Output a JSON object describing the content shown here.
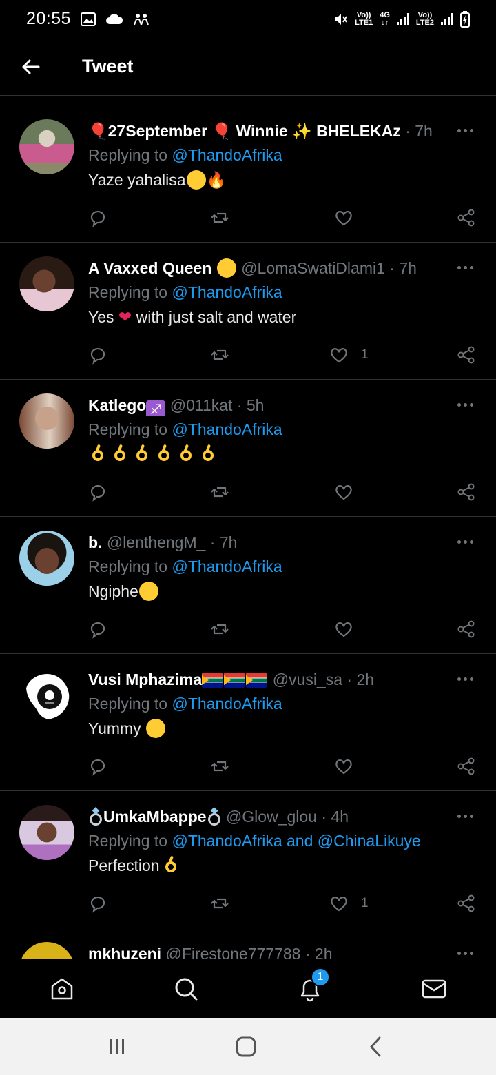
{
  "status_bar": {
    "time": "20:55",
    "sim1": "LTE1",
    "sim1_top": "Vo))",
    "sim2": "LTE2",
    "sim2_top": "Vo))",
    "net": "4G"
  },
  "header": {
    "title": "Tweet",
    "back_icon": "arrow-left-icon"
  },
  "tweets": [
    {
      "name": "27September",
      "name2": "Winnie",
      "name3": "BHELEKAᴢ",
      "handle": "",
      "time": "7h",
      "replying_prefix": "Replying to ",
      "replying_to": "@ThandoAfrika",
      "text": "Yaze yahalisa",
      "likes": "",
      "avatar_colors": [
        "#6b7a5a",
        "#c95b8f",
        "#d8d0c0"
      ]
    },
    {
      "name": "A Vaxxed Queen",
      "handle": "@LomaSwatiDlami1",
      "time": "7h",
      "replying_prefix": "Replying to ",
      "replying_to": "@ThandoAfrika",
      "text_a": "Yes",
      "text_b": "with just salt and water",
      "likes": "1",
      "avatar_colors": [
        "#5a3a2e",
        "#e8c7d4",
        "#2a1a14"
      ]
    },
    {
      "name": "Katlego",
      "handle": "@011kat",
      "time": "5h",
      "replying_prefix": "Replying to ",
      "replying_to": "@ThandoAfrika",
      "text": "",
      "likes": "",
      "avatar_colors": [
        "#c7a28a",
        "#7a4a36",
        "#e0cfc0"
      ]
    },
    {
      "name": "b.",
      "handle": "@lenthengM_",
      "time": "7h",
      "replying_prefix": "Replying to ",
      "replying_to": "@ThandoAfrika",
      "text": "Ngiphe",
      "likes": "",
      "avatar_colors": [
        "#1a1410",
        "#9ccfe8",
        "#6a4030"
      ]
    },
    {
      "name": "Vusi Mphazima",
      "handle": "@vusi_sa",
      "time": "2h",
      "replying_prefix": "Replying to ",
      "replying_to": "@ThandoAfrika",
      "text": "Yummy",
      "likes": "",
      "avatar_colors": [
        "#ffffff",
        "#111111",
        "#888888"
      ]
    },
    {
      "name": "UmkaMbappe",
      "handle": "@Glow_glou",
      "time": "4h",
      "replying_prefix": "Replying to ",
      "replying_to": "@ThandoAfrika",
      "replying_and": " and ",
      "replying_to2": "@ChinaLikuye",
      "text": "Perfection",
      "likes": "1",
      "avatar_colors": [
        "#d9c9e0",
        "#2a1a1a",
        "#b070c0"
      ]
    },
    {
      "name": "mkhuzeni",
      "handle": "@Firestone777788",
      "time": "2h",
      "avatar_colors": [
        "#d9b21a",
        "#e05a1a",
        "#6a2a8a"
      ]
    }
  ],
  "separator": "·",
  "bottom_nav": {
    "items": [
      "home-icon",
      "search-icon",
      "notifications-icon",
      "messages-icon"
    ],
    "notification_badge": "1"
  },
  "colors": {
    "accent": "#1d9bf0",
    "muted": "#71767b",
    "bg": "#000000"
  }
}
